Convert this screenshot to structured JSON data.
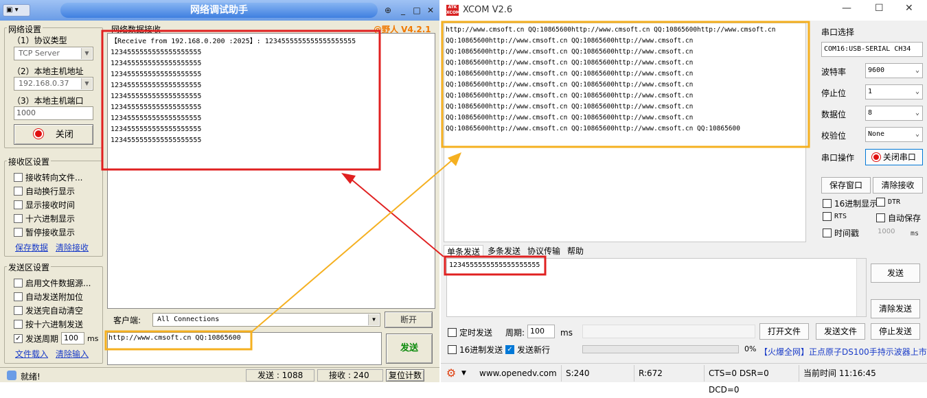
{
  "netassist": {
    "title": "网络调试助手",
    "version": "@野人 V4.2.1",
    "net_settings": {
      "title": "网络设置",
      "protocol_label": "（1）协议类型",
      "protocol_value": "TCP Server",
      "host_label": "（2）本地主机地址",
      "host_value": "192.168.0.37",
      "port_label": "（3）本地主机端口",
      "port_value": "1000",
      "close_label": "关闭"
    },
    "rx_settings": {
      "title": "接收区设置",
      "options": [
        "接收转向文件...",
        "自动换行显示",
        "显示接收时间",
        "十六进制显示",
        "暂停接收显示"
      ],
      "save_link": "保存数据",
      "clear_link": "清除接收"
    },
    "tx_settings": {
      "title": "发送区设置",
      "options": [
        "启用文件数据源...",
        "自动发送附加位",
        "发送完自动清空",
        "按十六进制发送"
      ],
      "period_label": "发送周期",
      "period_value": "100",
      "period_unit": "ms",
      "file_link": "文件载入",
      "clear_link": "清除输入"
    },
    "rx_area_label": "网络数据接收",
    "rx_lines": [
      "【Receive from 192.168.0.200 :2025】: 1234555555555555555555",
      "1234555555555555555555",
      "1234555555555555555555",
      "1234555555555555555555",
      "1234555555555555555555",
      "1234555555555555555555",
      "1234555555555555555555",
      "1234555555555555555555",
      "1234555555555555555555",
      "1234555555555555555555"
    ],
    "client_label": "客户端:",
    "client_value": "All Connections",
    "disconnect_label": "断开",
    "tx_text": "http://www.cmsoft.cn QQ:10865600",
    "send_label": "发送",
    "status_ready": "就绪!",
    "status_send": "发送 : 1088",
    "status_recv": "接收 : 240",
    "reset_label": "复位计数"
  },
  "xcom": {
    "title": "XCOM V2.6",
    "logo": "ATK XCOM",
    "rx_lines": [
      "http://www.cmsoft.cn QQ:10865600http://www.cmsoft.cn QQ:10865600http://www.cmsoft.cn",
      "QQ:10865600http://www.cmsoft.cn QQ:10865600http://www.cmsoft.cn",
      "QQ:10865600http://www.cmsoft.cn QQ:10865600http://www.cmsoft.cn",
      "QQ:10865600http://www.cmsoft.cn QQ:10865600http://www.cmsoft.cn",
      "QQ:10865600http://www.cmsoft.cn QQ:10865600http://www.cmsoft.cn",
      "QQ:10865600http://www.cmsoft.cn QQ:10865600http://www.cmsoft.cn",
      "QQ:10865600http://www.cmsoft.cn QQ:10865600http://www.cmsoft.cn",
      "QQ:10865600http://www.cmsoft.cn QQ:10865600http://www.cmsoft.cn",
      "QQ:10865600http://www.cmsoft.cn QQ:10865600http://www.cmsoft.cn",
      "QQ:10865600http://www.cmsoft.cn QQ:10865600http://www.cmsoft.cn QQ:10865600"
    ],
    "port_label": "串口选择",
    "port_value": "COM16:USB-SERIAL CH34",
    "baud_label": "波特率",
    "baud_value": "9600",
    "stop_label": "停止位",
    "stop_value": "1",
    "data_label": "数据位",
    "data_value": "8",
    "parity_label": "校验位",
    "parity_value": "None",
    "op_label": "串口操作",
    "close_port_label": "关闭串口",
    "save_window_label": "保存窗口",
    "clear_rx_label": "清除接收",
    "hex_display_label": "16进制显示",
    "dtr_label": "DTR",
    "rts_label": "RTS",
    "autosave_label": "自动保存",
    "timestamp_label": "时间戳",
    "timestamp_value": "1000",
    "timestamp_unit": "ms",
    "tabs": [
      "单条发送",
      "多条发送",
      "协议传输",
      "帮助"
    ],
    "tx_text": "1234555555555555555555",
    "send_label": "发送",
    "clear_send_label": "清除发送",
    "timed_send_label": "定时发送",
    "period_label": "周期:",
    "period_value": "100",
    "period_unit": "ms",
    "open_file_label": "打开文件",
    "send_file_label": "发送文件",
    "stop_send_label": "停止发送",
    "hex_send_label": "16进制发送",
    "newline_label": "发送新行",
    "progress_text": "0%",
    "progress_value": 0,
    "ad_text": "【火爆全网】正点原子DS100手持示波器上市",
    "status_url": "www.openedv.com",
    "status_s": "S:240",
    "status_r": "R:672",
    "status_lines": "CTS=0 DSR=0 DCD=0",
    "status_time": "当前时间 11:16:45"
  },
  "colors": {
    "highlight_red": "#e02020",
    "highlight_yellow": "#f5b020",
    "send_green": "#0a8a0a",
    "version_orange": "#f07800"
  }
}
